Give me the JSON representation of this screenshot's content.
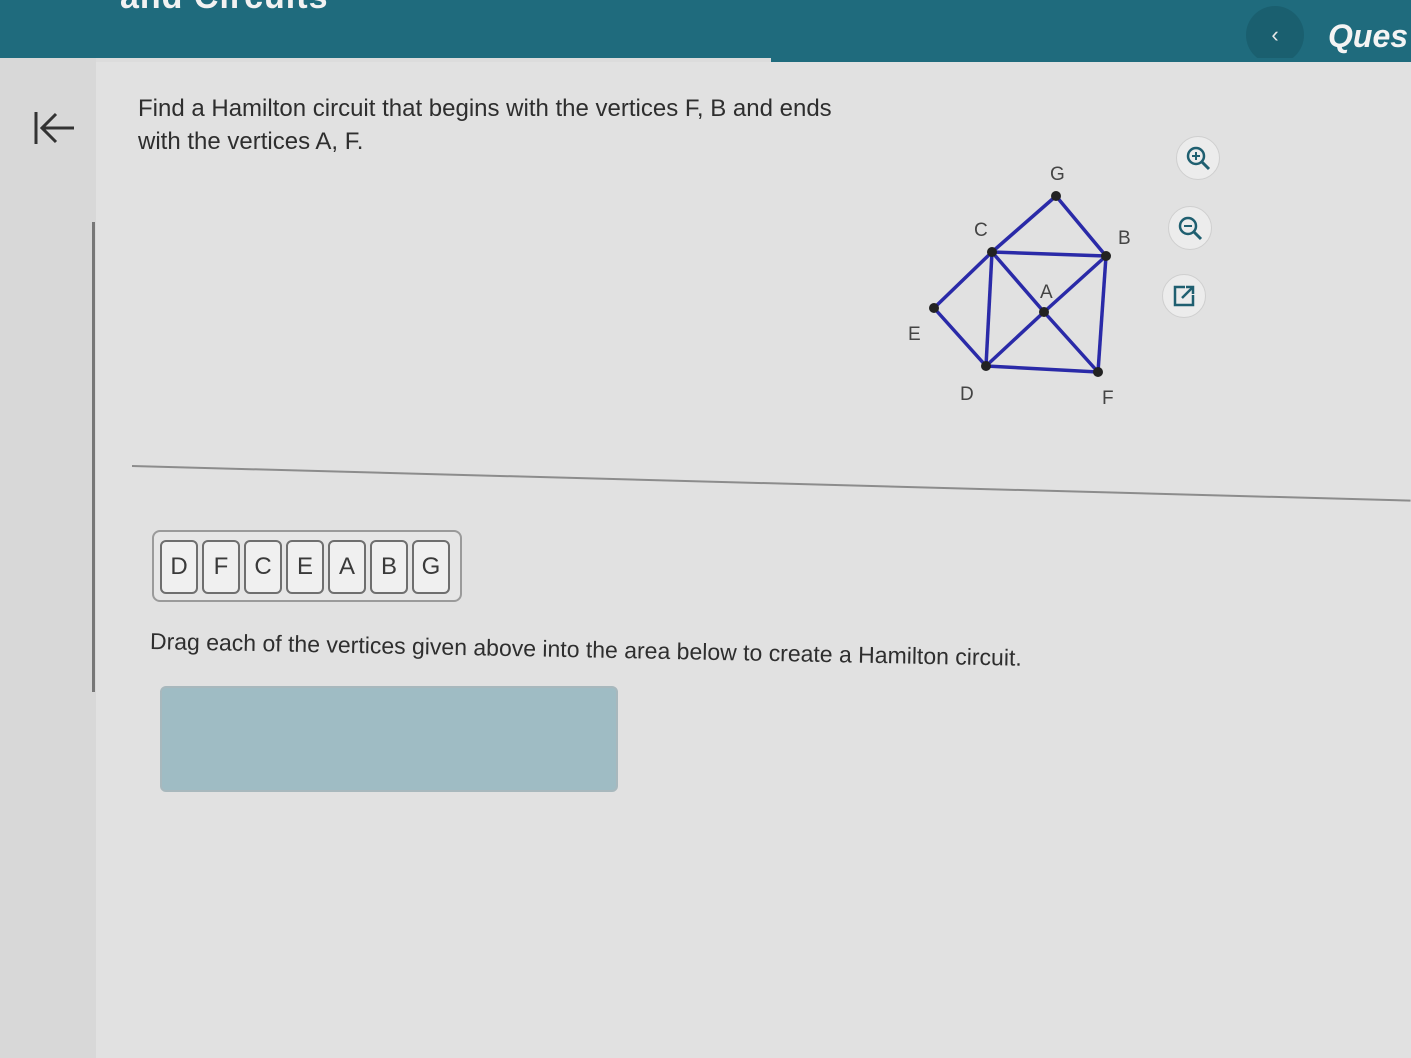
{
  "header": {
    "title": "and Circuits",
    "nav_prev": "‹",
    "question_label": "Ques"
  },
  "problem": {
    "text": "Find a Hamilton circuit that begins with the vertices F, B and ends with the vertices A, F."
  },
  "graph": {
    "vertices": [
      "G",
      "C",
      "B",
      "A",
      "E",
      "D",
      "F"
    ],
    "edges": [
      [
        "G",
        "C"
      ],
      [
        "G",
        "B"
      ],
      [
        "C",
        "B"
      ],
      [
        "C",
        "E"
      ],
      [
        "C",
        "D"
      ],
      [
        "C",
        "A"
      ],
      [
        "B",
        "A"
      ],
      [
        "B",
        "F"
      ],
      [
        "A",
        "F"
      ],
      [
        "A",
        "D"
      ],
      [
        "E",
        "D"
      ],
      [
        "D",
        "F"
      ]
    ],
    "edge_color": "#2a2aa8"
  },
  "tools": {
    "zoom_in": "zoom-in-icon",
    "zoom_out": "zoom-out-icon",
    "expand": "external-link-icon"
  },
  "tiles": [
    "D",
    "F",
    "C",
    "E",
    "A",
    "B",
    "G"
  ],
  "instruction": "Drag each of the vertices given above into the area below to create a Hamilton circuit.",
  "colors": {
    "header": "#1f6b7d",
    "drop_zone": "#9fbcc4"
  }
}
